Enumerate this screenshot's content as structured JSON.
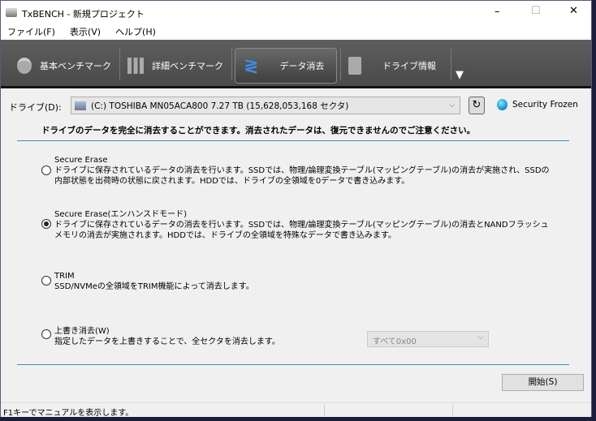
{
  "window": {
    "title": "TxBENCH - 新規プロジェクト",
    "minimize": "–",
    "maximize": "☐",
    "close": "✕"
  },
  "menu": [
    "ファイル(F)",
    "表示(V)",
    "ヘルプ(H)"
  ],
  "tabs": [
    {
      "label": "基本ベンチマーク"
    },
    {
      "label": "詳細ベンチマーク"
    },
    {
      "label": "データ消去"
    },
    {
      "label": "ドライブ情報"
    }
  ],
  "tab_overflow": "▼",
  "drive": {
    "label": "ドライブ(D):",
    "value": "(C:) TOSHIBA MN05ACA800  7.27 TB (15,628,053,168 セクタ)",
    "status": "Security Frozen",
    "status_color": "#1a9ad0"
  },
  "notice": "ドライブのデータを完全に消去することができます。消去されたデータは、復元できませんのでご注意ください。",
  "options": [
    {
      "title": "Secure Erase",
      "desc": "ドライブに保存されているデータの消去を行います。SSDでは、物理/論理変換テーブル(マッピングテーブル)の消去が実施され、SSDの内部状態を出荷時の状態に戻されます。HDDでは、ドライブの全領域を0データで書き込みます。",
      "selected": false
    },
    {
      "title": "Secure Erase(エンハンスドモード)",
      "desc": "ドライブに保存されているデータの消去を行います。SSDでは、物理/論理変換テーブル(マッピングテーブル)の消去とNANDフラッシュメモリの消去が実施されます。HDDでは、ドライブの全領域を特殊なデータで書き込みます。",
      "selected": true
    },
    {
      "title": "TRIM",
      "desc": "SSD/NVMeの全領域をTRIM機能によって消去します。",
      "selected": false
    },
    {
      "title": "上書き消去(W)",
      "desc": "指定したデータを上書きすることで、全セクタを消去します。",
      "selected": false
    }
  ],
  "overwrite_pattern": "すべて0x00",
  "start_button": "開始(S)",
  "statusbar": "F1キーでマニュアルを表示します。"
}
